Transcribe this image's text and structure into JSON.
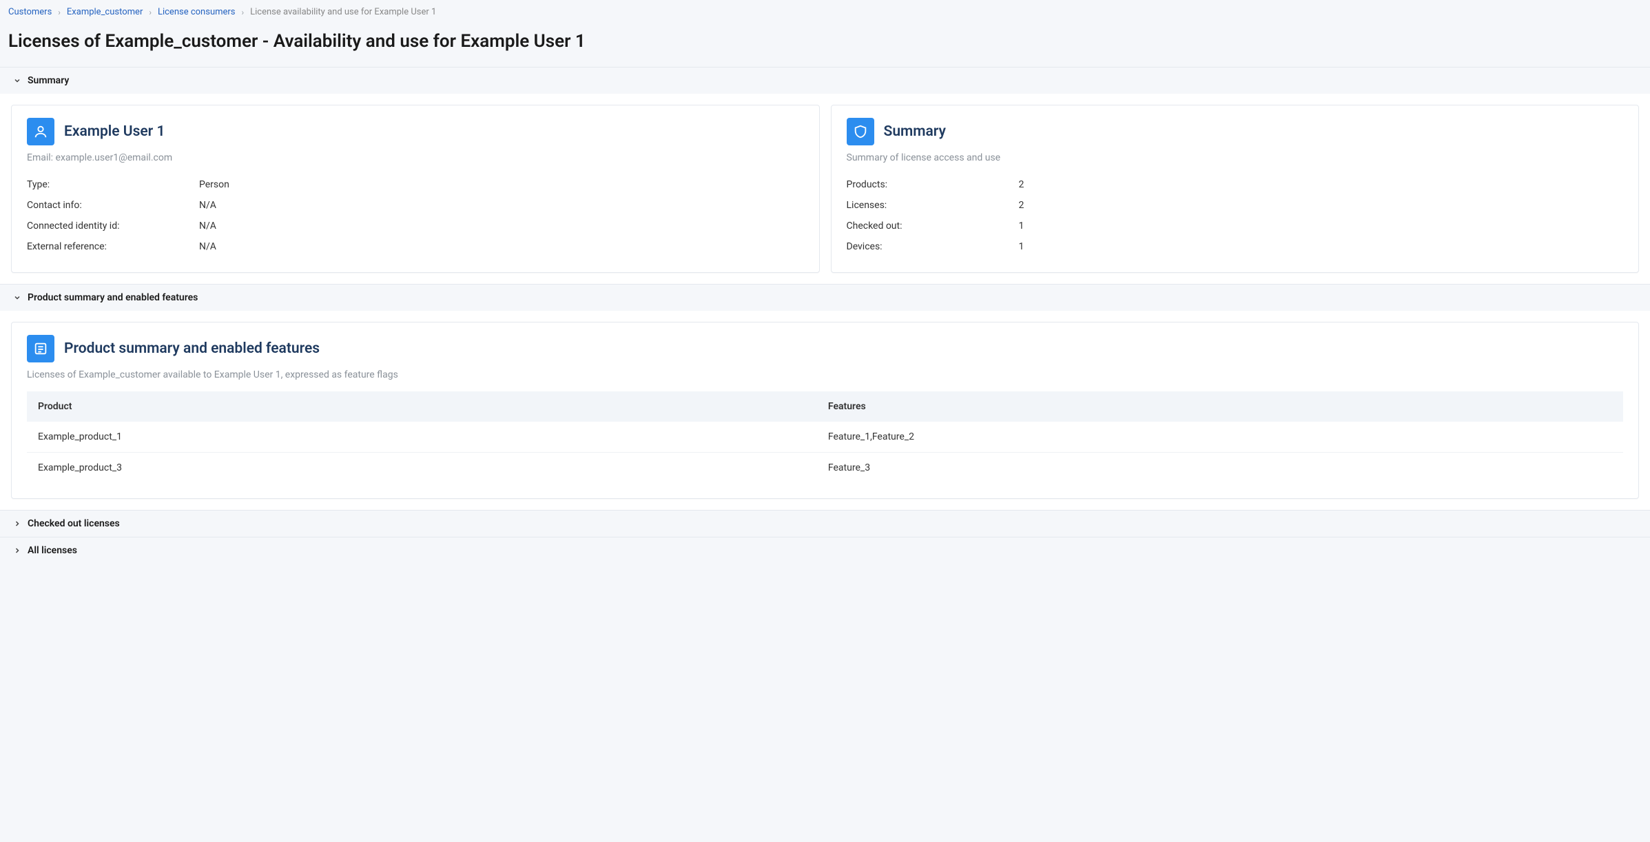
{
  "breadcrumb": {
    "customers": "Customers",
    "example_customer": "Example_customer",
    "license_consumers": "License consumers",
    "current": "License availability and use for Example User 1"
  },
  "page_title": "Licenses of Example_customer - Availability and use for Example User 1",
  "sections": {
    "summary_header": "Summary",
    "product_summary_header": "Product summary and enabled features",
    "checked_out_header": "Checked out licenses",
    "all_licenses_header": "All licenses"
  },
  "user_card": {
    "title": "Example User 1",
    "email_line": "Email: example.user1@email.com",
    "rows": [
      {
        "k": "Type:",
        "v": "Person"
      },
      {
        "k": "Contact info:",
        "v": "N/A"
      },
      {
        "k": "Connected identity id:",
        "v": "N/A"
      },
      {
        "k": "External reference:",
        "v": "N/A"
      }
    ]
  },
  "summary_card": {
    "title": "Summary",
    "sub": "Summary of license access and use",
    "rows": [
      {
        "k": "Products:",
        "v": "2"
      },
      {
        "k": "Licenses:",
        "v": "2"
      },
      {
        "k": "Checked out:",
        "v": "1"
      },
      {
        "k": "Devices:",
        "v": "1"
      }
    ]
  },
  "product_card": {
    "title": "Product summary and enabled features",
    "sub": "Licenses of Example_customer available to Example User 1, expressed as feature flags",
    "headers": {
      "product": "Product",
      "features": "Features"
    },
    "rows": [
      {
        "product": "Example_product_1",
        "features": "Feature_1,Feature_2"
      },
      {
        "product": "Example_product_3",
        "features": "Feature_3"
      }
    ]
  }
}
